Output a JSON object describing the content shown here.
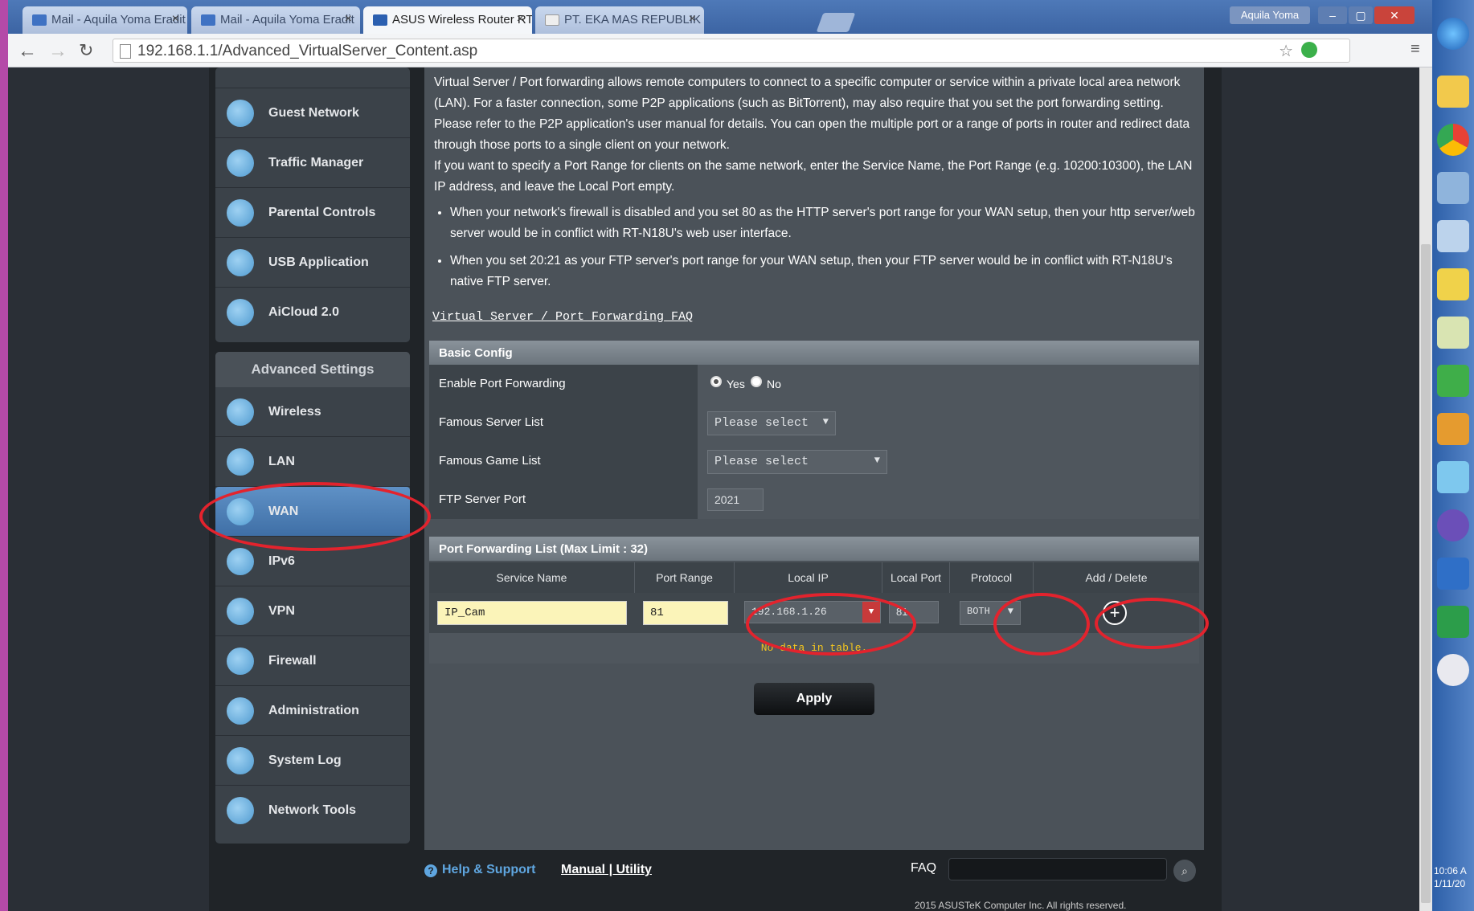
{
  "browser": {
    "tabs": [
      {
        "label": "Mail - Aquila Yoma Eradit",
        "icon_color": "#3f72c3"
      },
      {
        "label": "Mail - Aquila Yoma Eradit",
        "icon_color": "#3f72c3"
      },
      {
        "label": "ASUS Wireless Router RT",
        "icon_color": "#2b5fb0"
      },
      {
        "label": "PT. EKA MAS REPUBLIK",
        "icon_color": "#cccccc"
      }
    ],
    "user": "Aquila Yoma",
    "url": "192.168.1.1/Advanced_VirtualServer_Content.asp"
  },
  "sidebar": {
    "general_items": [
      {
        "label": "Guest Network",
        "icon": "guest-network-icon"
      },
      {
        "label": "Traffic Manager",
        "icon": "traffic-manager-icon"
      },
      {
        "label": "Parental Controls",
        "icon": "lock-icon"
      },
      {
        "label": "USB Application",
        "icon": "puzzle-icon"
      },
      {
        "label": "AiCloud 2.0",
        "icon": "cloud-house-icon"
      }
    ],
    "advanced_title": "Advanced Settings",
    "advanced_items": [
      {
        "label": "Wireless",
        "icon": "wifi-icon"
      },
      {
        "label": "LAN",
        "icon": "home-icon"
      },
      {
        "label": "WAN",
        "icon": "globe-icon"
      },
      {
        "label": "IPv6",
        "icon": "ipv6-globe-icon"
      },
      {
        "label": "VPN",
        "icon": "vpn-icon"
      },
      {
        "label": "Firewall",
        "icon": "shield-icon"
      },
      {
        "label": "Administration",
        "icon": "user-icon"
      },
      {
        "label": "System Log",
        "icon": "log-icon"
      },
      {
        "label": "Network Tools",
        "icon": "tools-icon"
      }
    ]
  },
  "main": {
    "desc_p1": "Virtual Server / Port forwarding allows remote computers to connect to a specific computer or service within a private local area network (LAN). For a faster connection, some P2P applications (such as BitTorrent), may also require that you set the port forwarding setting. Please refer to the P2P application's user manual for details. You can open the multiple port or a range of ports in router and redirect data through those ports to a single client on your network.",
    "desc_p2": "If you want to specify a Port Range for clients on the same network, enter the Service Name, the Port Range (e.g. 10200:10300), the LAN IP address, and leave the Local Port empty.",
    "bullet1": "When your network's firewall is disabled and you set 80 as the HTTP server's port range for your WAN setup, then your http server/web server would be in conflict with RT-N18U's web user interface.",
    "bullet2": "When you set 20:21 as your FTP server's port range for your WAN setup, then your FTP server would be in conflict with RT-N18U's native FTP server.",
    "faq_link": "Virtual Server / Port Forwarding FAQ",
    "basic_config": {
      "title": "Basic Config",
      "enable_label": "Enable Port Forwarding",
      "yes": "Yes",
      "no": "No",
      "famous_server_label": "Famous Server List",
      "famous_server_value": "Please select",
      "famous_game_label": "Famous Game List",
      "famous_game_value": "Please select",
      "ftp_label": "FTP Server Port",
      "ftp_value": "2021"
    },
    "pf_list": {
      "title": "Port Forwarding List (Max Limit : 32)",
      "columns": [
        "Service Name",
        "Port Range",
        "Local IP",
        "Local Port",
        "Protocol",
        "Add / Delete"
      ],
      "row": {
        "service": "IP_Cam",
        "port_range": "81",
        "local_ip": "192.168.1.26",
        "local_port": "81",
        "protocol": "BOTH"
      },
      "no_data": "No data in table."
    },
    "apply": "Apply"
  },
  "footer": {
    "help": "Help & Support",
    "links": "Manual | Utility",
    "faq": "FAQ",
    "copyright": "2015 ASUSTeK Computer Inc. All rights reserved."
  },
  "taskbar": {
    "time": "10:06 A",
    "date": "1/11/20"
  },
  "colors": {
    "highlight_ring": "#e3232d",
    "selected_item": "#4f82bb",
    "yellow_input": "#fbf4b9"
  }
}
